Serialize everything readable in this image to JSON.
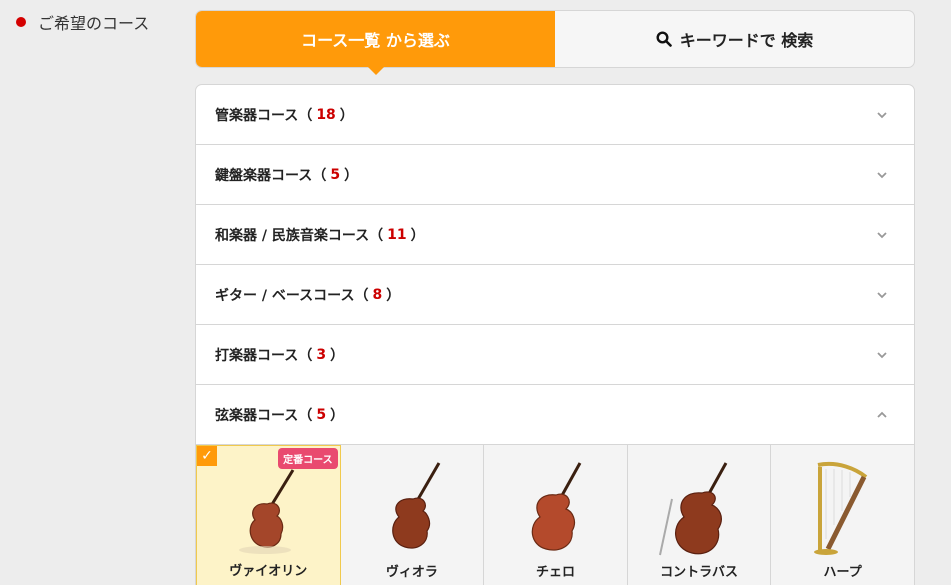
{
  "side": {
    "label": "ご希望のコース"
  },
  "tabs": {
    "list_label": "コース一覧 から選ぶ",
    "search_label": "キーワードで 検索"
  },
  "categories": [
    {
      "name": "管楽器コース",
      "count": "18",
      "expanded": false
    },
    {
      "name": "鍵盤楽器コース",
      "count": "5",
      "expanded": false
    },
    {
      "name": "和楽器 / 民族音楽コース",
      "count": "11",
      "expanded": false
    },
    {
      "name": "ギター / ベースコース",
      "count": "8",
      "expanded": false
    },
    {
      "name": "打楽器コース",
      "count": "3",
      "expanded": false
    },
    {
      "name": "弦楽器コース",
      "count": "5",
      "expanded": true
    }
  ],
  "instruments": [
    {
      "name": "ヴァイオリン",
      "selected": true,
      "badge": "定番コース"
    },
    {
      "name": "ヴィオラ",
      "selected": false
    },
    {
      "name": "チェロ",
      "selected": false
    },
    {
      "name": "コントラバス",
      "selected": false
    },
    {
      "name": "ハープ",
      "selected": false
    }
  ],
  "colors": {
    "accent": "#ff9a0a",
    "count_red": "#cc0000",
    "badge": "#e94a6f",
    "dot": "#d40000"
  }
}
